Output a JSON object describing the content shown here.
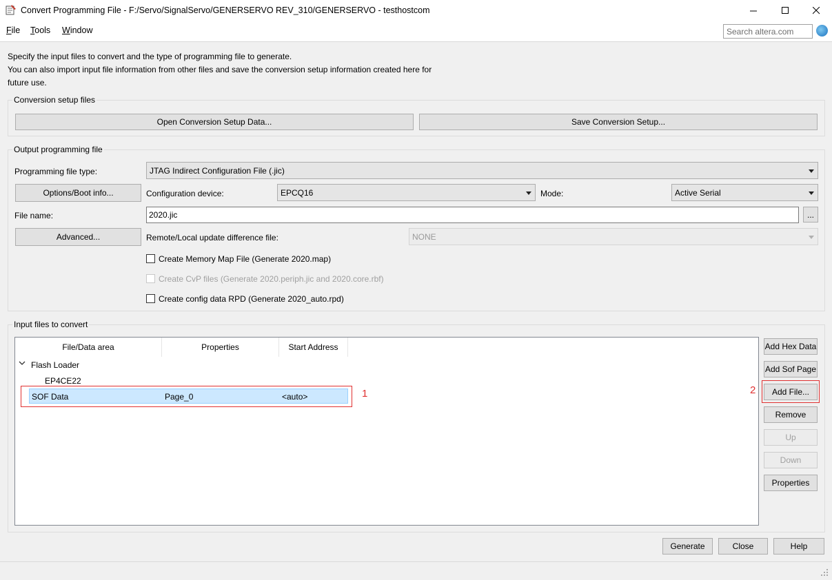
{
  "window": {
    "title": "Convert Programming File - F:/Servo/SignalServo/GENERSERVO REV_310/GENERSERVO - testhostcom"
  },
  "menu": {
    "file_underline": "F",
    "file_rest": "ile",
    "tools_underline": "T",
    "tools_rest": "ools",
    "window_underline": "W",
    "window_rest": "indow"
  },
  "search": {
    "placeholder": "Search altera.com"
  },
  "intro": {
    "line1": "Specify the input files to convert and the type of programming file to generate.",
    "line2": "You can also import input file information from other files and save the conversion setup information created here for",
    "line3": "future use."
  },
  "conversion_setup": {
    "title": "Conversion setup files",
    "open_button": "Open Conversion Setup Data...",
    "save_button": "Save Conversion Setup..."
  },
  "output": {
    "title": "Output programming file",
    "file_type_label": "Programming file type:",
    "file_type_value": "JTAG Indirect Configuration File (.jic)",
    "options_button": "Options/Boot info...",
    "config_device_label": "Configuration device:",
    "config_device_value": "EPCQ16",
    "mode_label": "Mode:",
    "mode_value": "Active Serial",
    "file_name_label": "File name:",
    "file_name_value": "2020.jic",
    "browse_button": "...",
    "advanced_button": "Advanced...",
    "remote_label": "Remote/Local update difference file:",
    "remote_value": "NONE",
    "chk_memory_map": "Create Memory Map File (Generate 2020.map)",
    "chk_cvp": "Create CvP files (Generate 2020.periph.jic and 2020.core.rbf)",
    "chk_rpd": "Create config data RPD (Generate 2020_auto.rpd)"
  },
  "input": {
    "title": "Input files to convert",
    "columns": [
      "File/Data area",
      "Properties",
      "Start Address"
    ],
    "flash_loader": "Flash Loader",
    "device": "EP4CE22",
    "row": {
      "name": "SOF Data",
      "properties": "Page_0",
      "start": "<auto>"
    },
    "buttons": {
      "add_hex": "Add Hex Data",
      "add_sof": "Add Sof Page",
      "add_file": "Add File...",
      "remove": "Remove",
      "up": "Up",
      "down": "Down",
      "properties": "Properties"
    }
  },
  "annotations": {
    "one": "1",
    "two": "2"
  },
  "footer": {
    "generate": "Generate",
    "close": "Close",
    "help": "Help"
  },
  "colors": {
    "selection": "#cce8ff",
    "annotation_red": "#e03030"
  }
}
